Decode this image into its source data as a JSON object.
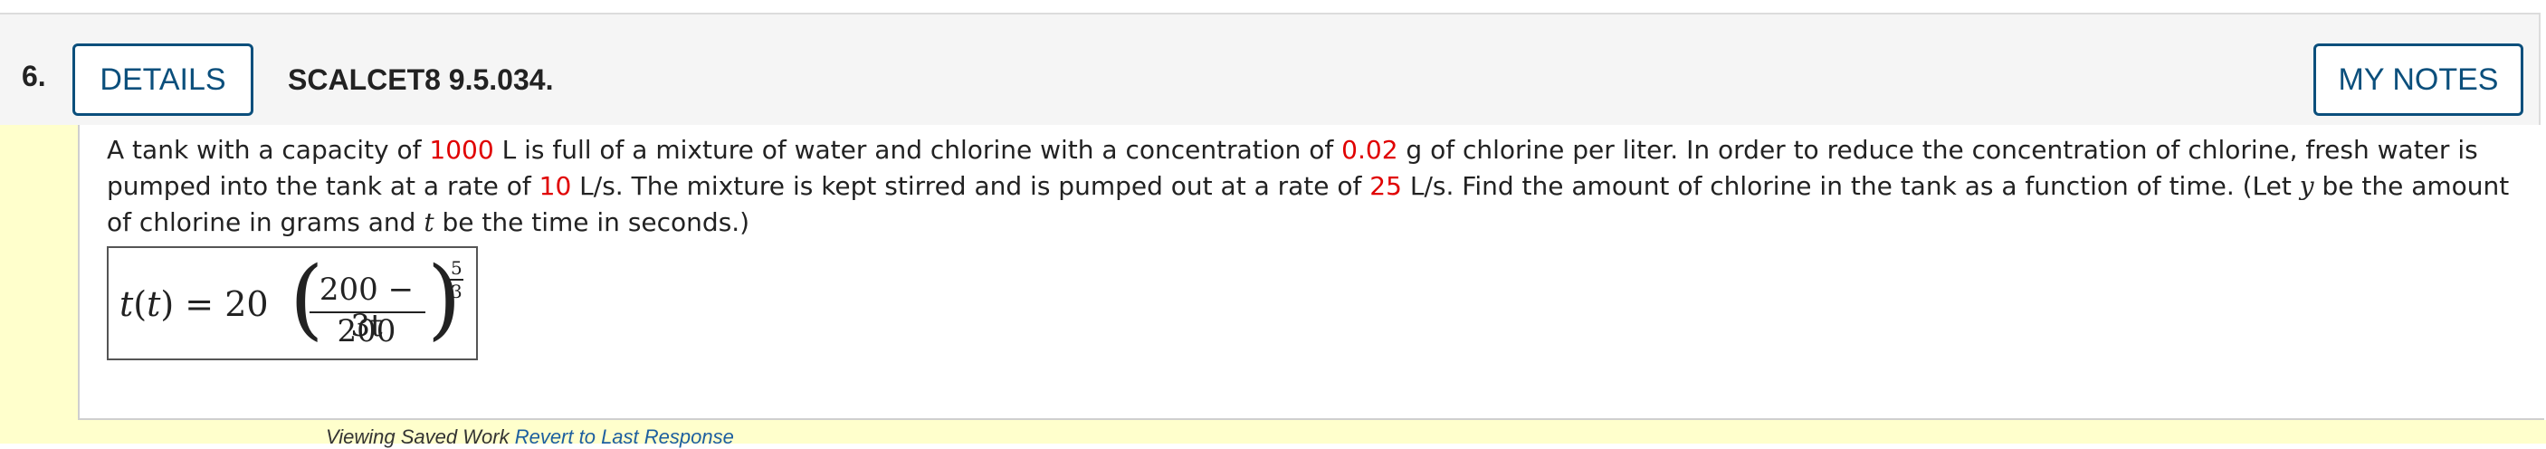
{
  "question": {
    "number": "6.",
    "details_label": "DETAILS",
    "code": "SCALCET8 9.5.034.",
    "my_notes_label": "MY NOTES"
  },
  "body": {
    "segments": [
      {
        "text": "A tank with a capacity of ",
        "style": "normal"
      },
      {
        "text": "1000",
        "style": "red"
      },
      {
        "text": " L is full of a mixture of water and chlorine with a concentration of ",
        "style": "normal"
      },
      {
        "text": "0.02",
        "style": "red"
      },
      {
        "text": " g of chlorine per liter. In order to reduce the concentration of chlorine, fresh water is pumped into the tank at a rate of ",
        "style": "normal"
      },
      {
        "text": "10",
        "style": "red"
      },
      {
        "text": " L/s. The mixture is kept stirred and is pumped out at a rate of ",
        "style": "normal"
      },
      {
        "text": "25",
        "style": "red"
      },
      {
        "text": " L/s. Find the amount of chlorine in the tank as a function of time. (Let ",
        "style": "normal"
      },
      {
        "text": "y",
        "style": "italic"
      },
      {
        "text": " be the amount of chlorine in grams and ",
        "style": "normal"
      },
      {
        "text": "t",
        "style": "italic"
      },
      {
        "text": " be the time in seconds.)",
        "style": "normal"
      }
    ]
  },
  "answer": {
    "lhs_fn": "t",
    "lhs_arg": "t",
    "equals_coef": "= 20",
    "numerator": "200 − 3t",
    "denominator": "200",
    "exp_numerator": "5",
    "exp_denominator": "3"
  },
  "footer": {
    "viewing_label": "Viewing Saved Work",
    "revert_label": "Revert to Last Response"
  },
  "colors": {
    "accent": "#0b4f7c",
    "highlight_red": "#e00000",
    "left_bar": "#ffffcc"
  }
}
